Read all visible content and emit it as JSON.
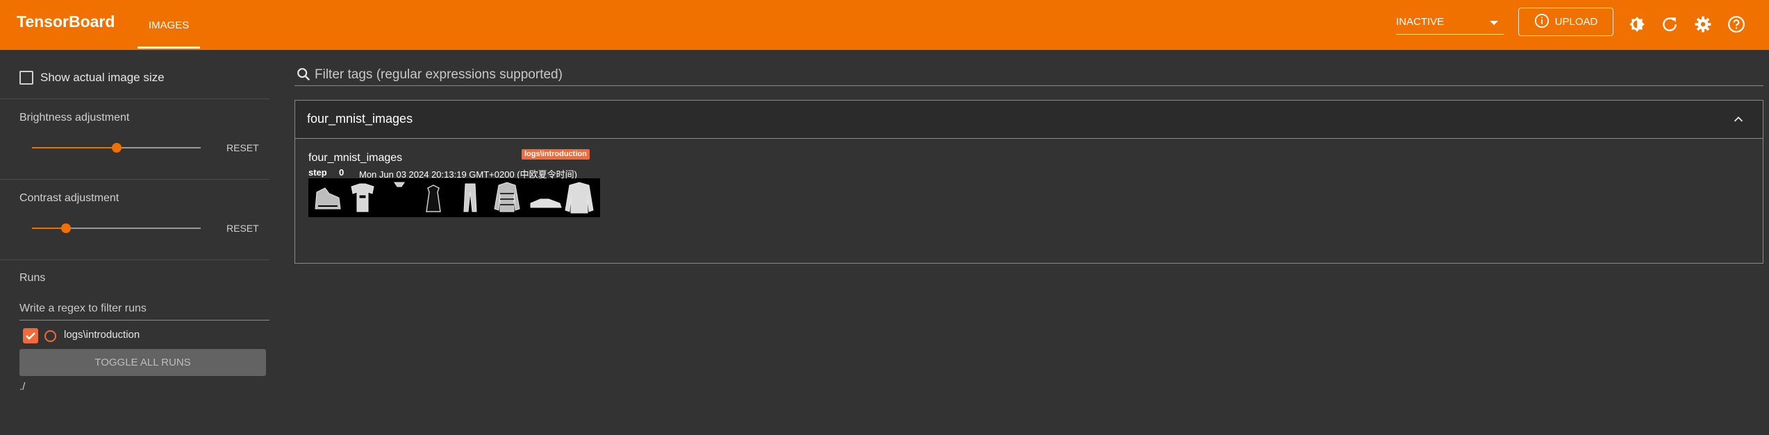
{
  "header": {
    "brand": "TensorBoard",
    "tabs": [
      {
        "label": "IMAGES",
        "active": true
      }
    ],
    "status_select": {
      "value": "INACTIVE"
    },
    "upload_label": "UPLOAD",
    "icons": [
      "brightness-icon",
      "refresh-icon",
      "settings-icon",
      "help-icon"
    ],
    "accent_color": "#f07000"
  },
  "sidebar": {
    "show_actual_size_label": "Show actual image size",
    "show_actual_size_checked": false,
    "brightness": {
      "label": "Brightness adjustment",
      "reset_label": "RESET",
      "value_fraction": 0.5
    },
    "contrast": {
      "label": "Contrast adjustment",
      "reset_label": "RESET",
      "value_fraction": 0.2
    },
    "runs": {
      "title": "Runs",
      "filter_placeholder": "Write a regex to filter runs",
      "items": [
        {
          "label": "logs\\introduction",
          "checked": true,
          "color": "#f06a3a"
        }
      ],
      "toggle_all_label": "TOGGLE ALL RUNS",
      "path": "./"
    }
  },
  "main": {
    "filter_placeholder": "Filter tags (regular expressions supported)",
    "group": {
      "title": "four_mnist_images",
      "card": {
        "title": "four_mnist_images",
        "run_badge": "logs\\introduction",
        "step_label": "step",
        "step_value": "0",
        "timestamp": "Mon Jun 03 2024 20:13:19 GMT+0200 (中欧夏令时间)"
      }
    }
  }
}
